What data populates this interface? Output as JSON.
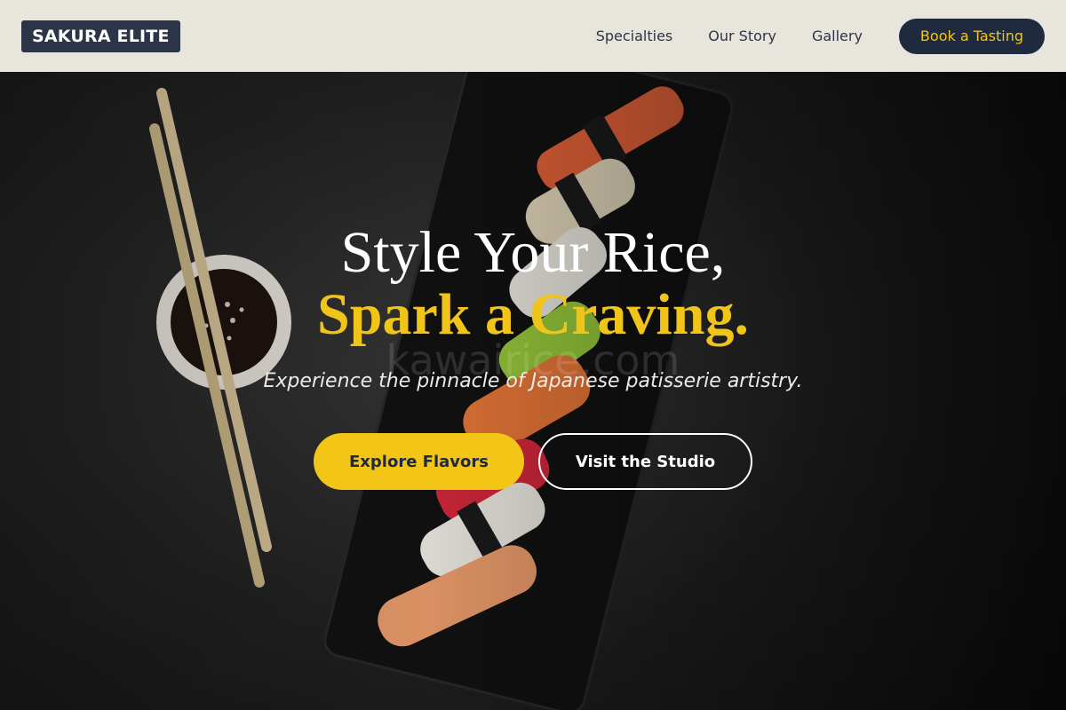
{
  "brand": {
    "logo_text": "SAKURA ELITE"
  },
  "nav": {
    "links": [
      "Specialties",
      "Our Story",
      "Gallery"
    ],
    "cta_label": "Book a Tasting"
  },
  "hero": {
    "headline_line1": "Style Your Rice,",
    "headline_line2": "Spark a Craving.",
    "watermark": "kawairice.com",
    "subtitle": "Experience the pinnacle of Japanese patisserie artistry.",
    "primary_button": "Explore Flavors",
    "secondary_button": "Visit the Studio",
    "background_image": "sushi-platter-chopsticks-soy-sauce"
  },
  "colors": {
    "header_bg": "#e8e6dc",
    "navy": "#1f2a3f",
    "accent_yellow": "#f2c516",
    "white": "#ffffff"
  }
}
